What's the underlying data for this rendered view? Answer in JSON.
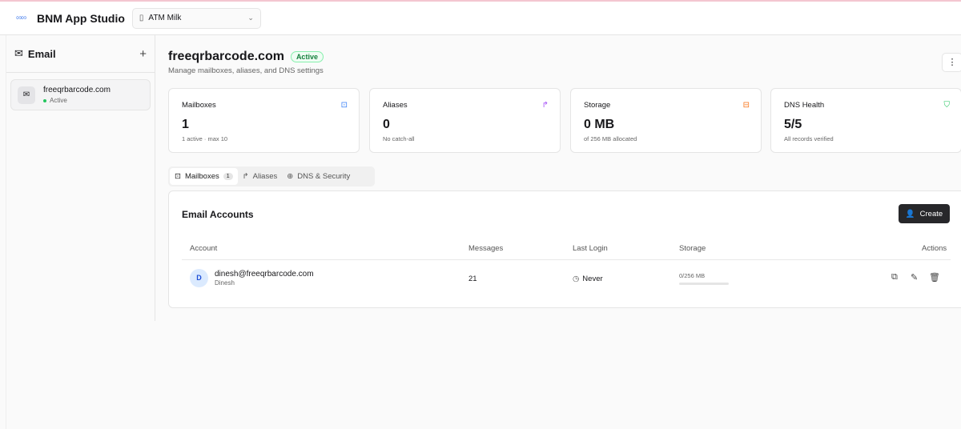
{
  "app": {
    "name": "BNM App Studio",
    "logo": "infinity-logo",
    "org": "ATM Milk"
  },
  "sidebar": {
    "title": "Email",
    "items": [
      {
        "name": "freeqrbarcode.com",
        "status": "Active"
      }
    ]
  },
  "domain": {
    "name": "freeqrbarcode.com",
    "status": "Active",
    "subtitle": "Manage mailboxes, aliases, and DNS settings"
  },
  "stats": [
    {
      "label": "Mailboxes",
      "value": "1",
      "note": "1 active · max 10",
      "icon": "inbox-icon",
      "color": "#3b82f6"
    },
    {
      "label": "Aliases",
      "value": "0",
      "note": "No catch-all",
      "icon": "forward-icon",
      "color": "#a855f7"
    },
    {
      "label": "Storage",
      "value": "0 MB",
      "note": "of 256 MB allocated",
      "icon": "hard-drive-icon",
      "color": "#f97316"
    },
    {
      "label": "DNS Health",
      "value": "5/5",
      "note": "All records verified",
      "icon": "shield-check-icon",
      "color": "#22c55e"
    }
  ],
  "tabs": [
    {
      "label": "Mailboxes",
      "count": "1"
    },
    {
      "label": "Aliases"
    },
    {
      "label": "DNS & Security"
    }
  ],
  "panel": {
    "title": "Email Accounts",
    "create": "Create",
    "columns": [
      "Account",
      "Messages",
      "Last Login",
      "Storage",
      "Actions"
    ],
    "rows": [
      {
        "initial": "D",
        "email": "dinesh@freeqrbarcode.com",
        "name": "Dinesh",
        "messages": "21",
        "last_login": "Never",
        "storage": "0/256 MB",
        "storage_fraction": 0
      }
    ]
  }
}
